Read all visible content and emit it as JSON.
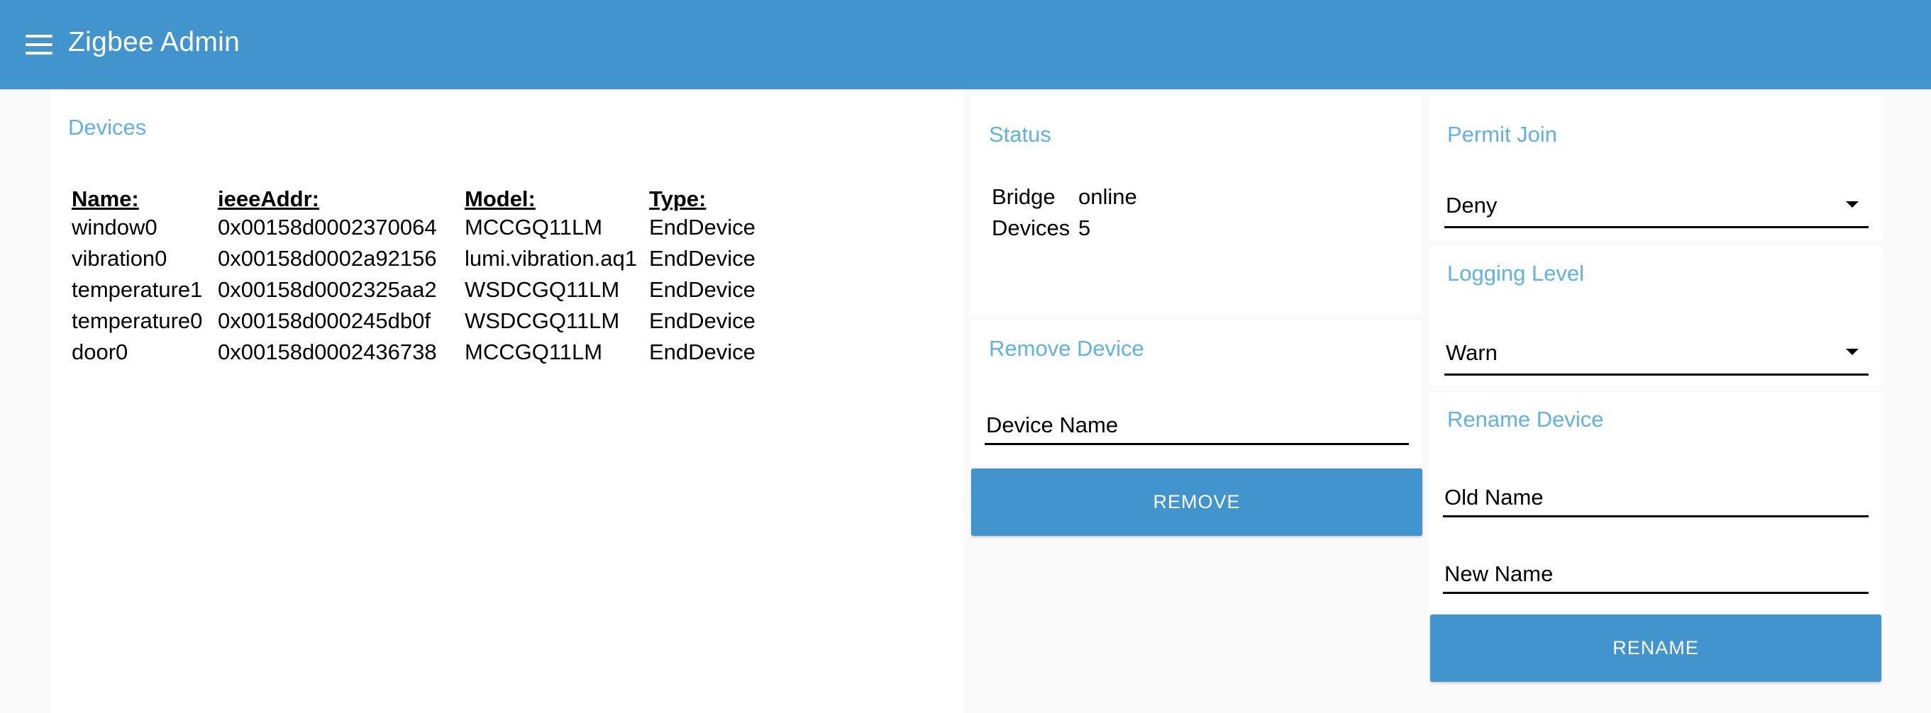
{
  "app": {
    "title": "Zigbee Admin",
    "accent": "#4194cc",
    "title_color": "#5fb2e3"
  },
  "devices": {
    "title": "Devices",
    "columns": [
      "Name:",
      "ieeeAddr:",
      "Model:",
      "Type:"
    ],
    "rows": [
      [
        "window0",
        "0x00158d0002370064",
        "MCCGQ11LM",
        "EndDevice"
      ],
      [
        "vibration0",
        "0x00158d0002a92156",
        "lumi.vibration.aq1",
        "EndDevice"
      ],
      [
        "temperature1",
        "0x00158d0002325aa2",
        "WSDCGQ11LM",
        "EndDevice"
      ],
      [
        "temperature0",
        "0x00158d000245db0f",
        "WSDCGQ11LM",
        "EndDevice"
      ],
      [
        "door0",
        "0x00158d0002436738",
        "MCCGQ11LM",
        "EndDevice"
      ]
    ]
  },
  "status": {
    "title": "Status",
    "bridge_label": "Bridge",
    "bridge_value": "online",
    "devices_label": "Devices",
    "devices_value": "5"
  },
  "remove_device": {
    "title": "Remove Device",
    "placeholder": "Device Name",
    "button_label": "REMOVE"
  },
  "permit_join": {
    "title": "Permit Join",
    "selected": "Deny"
  },
  "logging_level": {
    "title": "Logging Level",
    "selected": "Warn"
  },
  "rename_device": {
    "title": "Rename Device",
    "old_name_placeholder": "Old Name",
    "new_name_placeholder": "New Name",
    "button_label": "RENAME"
  }
}
